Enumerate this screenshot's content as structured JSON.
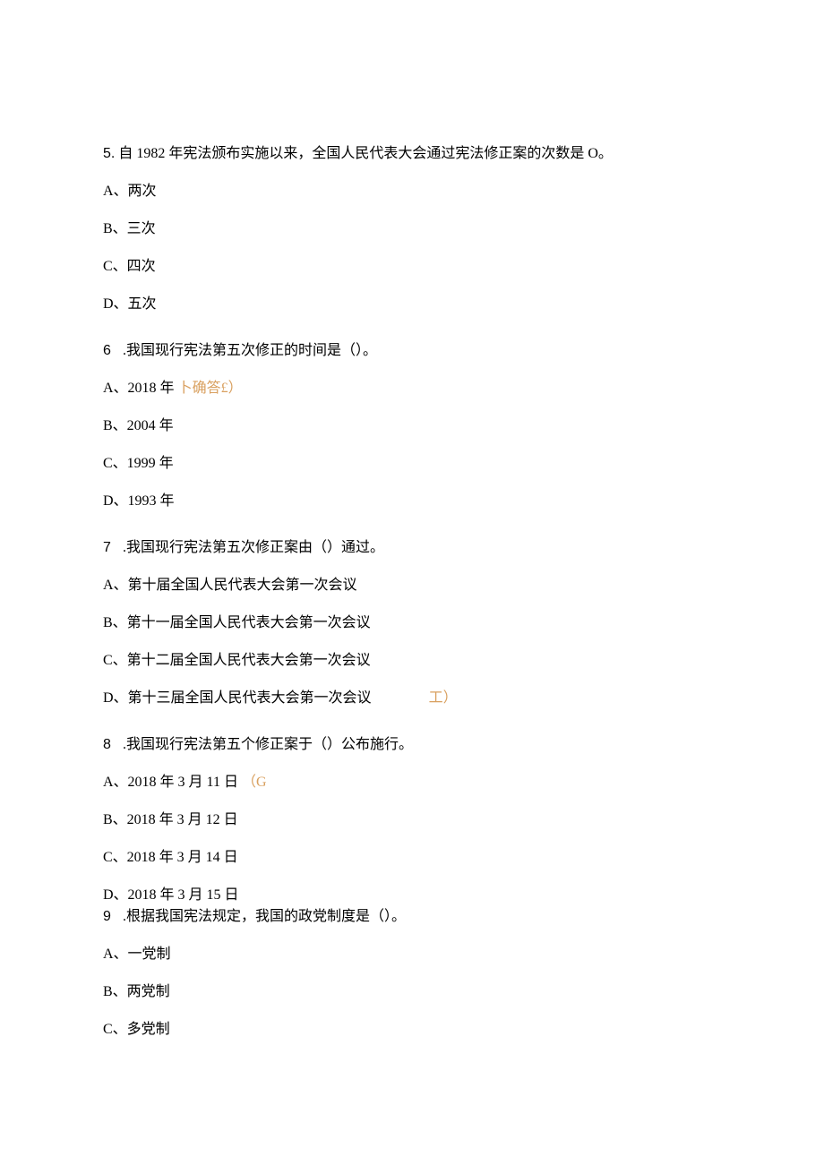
{
  "q5": {
    "stem_a": "5.",
    "stem_b": "自 1982 年宪法颁布实施以来，全国人民代表大会通过宪法修正案的次数是 O。",
    "A": "A、两次",
    "B": "B、三次",
    "C": "C、四次",
    "D": "D、五次"
  },
  "q6": {
    "num": "6",
    "stem": " .我国现行宪法第五次修正的时间是（）。",
    "A_pre": "A、2018 年",
    "A_ans": "卜确答£）",
    "B": "B、2004 年",
    "C": "C、1999 年",
    "D": "D、1993 年"
  },
  "q7": {
    "num": "7",
    "stem": " .我国现行宪法第五次修正案由（）通过。",
    "A": "A、第十届全国人民代表大会第一次会议",
    "B": "B、第十一届全国人民代表大会第一次会议",
    "C": "C、第十二届全国人民代表大会第一次会议",
    "D_pre": "D、第十三届全国人民代表大会第一次会议",
    "D_ans": "工）"
  },
  "q8": {
    "num": "8",
    "stem": " .我国现行宪法第五个修正案于（）公布施行。",
    "A_pre": "A、2018 年 3 月 11 日",
    "A_ans": "（G",
    "B": "B、2018 年 3 月 12 日",
    "C": "C、2018 年 3 月 14 日",
    "D": "D、2018 年 3 月 15 日"
  },
  "q9": {
    "num": "9",
    "stem": " .根据我国宪法规定，我国的政党制度是（）。",
    "A": "A、一党制",
    "B": "B、两党制",
    "C": "C、多党制"
  }
}
